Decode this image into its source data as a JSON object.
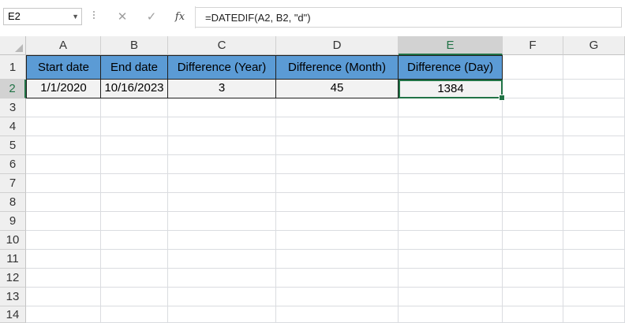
{
  "formula_bar": {
    "name_box": "E2",
    "cancel_glyph": "✕",
    "enter_glyph": "✓",
    "fx_label": "fx",
    "formula": "=DATEDIF(A2, B2, \"d\")"
  },
  "columns": [
    "A",
    "B",
    "C",
    "D",
    "E",
    "F",
    "G"
  ],
  "rows": [
    "1",
    "2",
    "3",
    "4",
    "5",
    "6",
    "7",
    "8",
    "9",
    "10",
    "11",
    "12",
    "13",
    "14"
  ],
  "table": {
    "headers": [
      "Start date",
      "End date",
      "Difference (Year)",
      "Difference (Month)",
      "Difference (Day)"
    ],
    "row": [
      "1/1/2020",
      "10/16/2023",
      "3",
      "45",
      "1384"
    ]
  },
  "selection": {
    "cell": "E2",
    "column": "E",
    "row": "2"
  },
  "colors": {
    "header_fill": "#5b9bd5",
    "data_fill": "#f2f2f2",
    "selection_accent": "#217346"
  }
}
